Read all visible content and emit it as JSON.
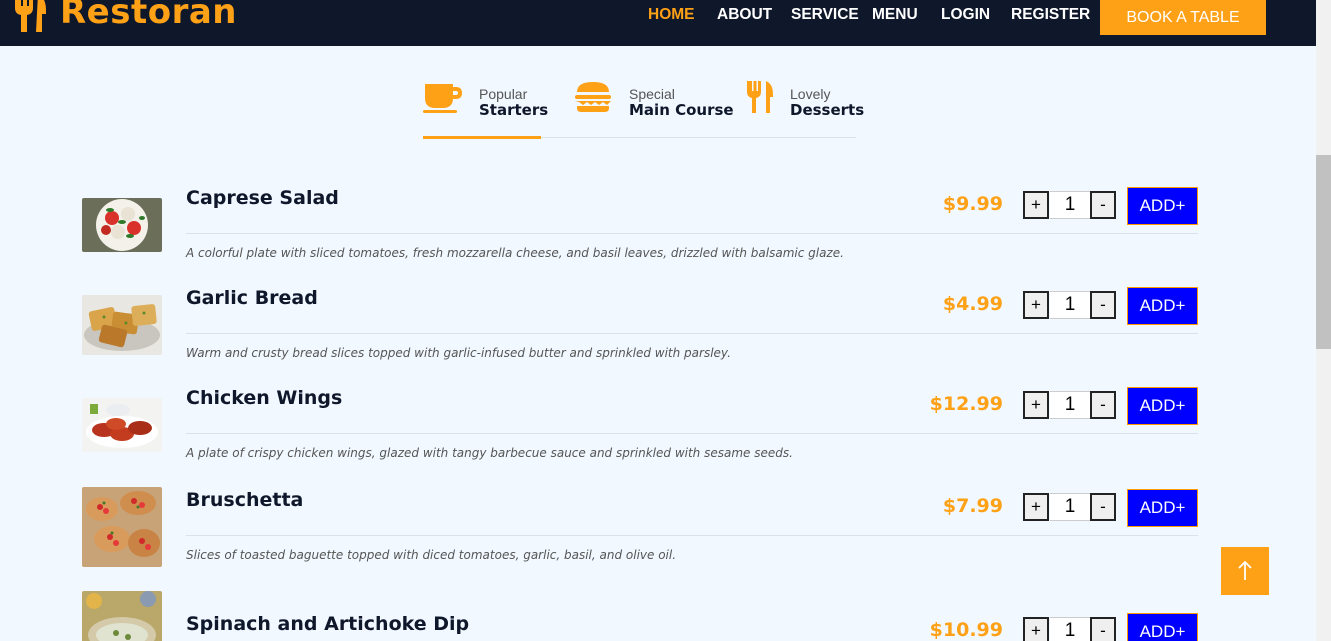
{
  "brand": {
    "name": "Restoran",
    "icon": "utensils-icon",
    "color": "#fea116"
  },
  "nav": {
    "links": [
      "HOME",
      "ABOUT",
      "SERVICE",
      "MENU",
      "LOGIN",
      "REGISTER"
    ],
    "active": "HOME",
    "cta": "BOOK A TABLE"
  },
  "tabs": [
    {
      "small": "Popular",
      "big": "Starters",
      "icon": "coffee-cup-icon",
      "active": true
    },
    {
      "small": "Special",
      "big": "Main Course",
      "icon": "hamburger-icon",
      "active": false
    },
    {
      "small": "Lovely",
      "big": "Desserts",
      "icon": "utensils-icon",
      "active": false
    }
  ],
  "items": [
    {
      "name": "Caprese Salad",
      "price": "$9.99",
      "qty": "1",
      "add": "ADD+",
      "desc": "A colorful plate with sliced tomatoes, fresh mozzarella cheese, and basil leaves, drizzled with balsamic glaze."
    },
    {
      "name": "Garlic Bread",
      "price": "$4.99",
      "qty": "1",
      "add": "ADD+",
      "desc": "Warm and crusty bread slices topped with garlic-infused butter and sprinkled with parsley."
    },
    {
      "name": "Chicken Wings",
      "price": "$12.99",
      "qty": "1",
      "add": "ADD+",
      "desc": "A plate of crispy chicken wings, glazed with tangy barbecue sauce and sprinkled with sesame seeds."
    },
    {
      "name": "Bruschetta",
      "price": "$7.99",
      "qty": "1",
      "add": "ADD+",
      "desc": "Slices of toasted baguette topped with diced tomatoes, garlic, basil, and olive oil."
    },
    {
      "name": "Spinach and Artichoke Dip",
      "price": "$10.99",
      "qty": "1",
      "add": "ADD+",
      "desc": ""
    }
  ],
  "qty_controls": {
    "plus": "+",
    "minus": "-"
  },
  "back_to_top": {
    "icon": "arrow-up-icon"
  },
  "colors": {
    "accent": "#fea116",
    "navbar": "#0f172b",
    "add_button": "#0000ff",
    "background": "#f1f8ff"
  }
}
